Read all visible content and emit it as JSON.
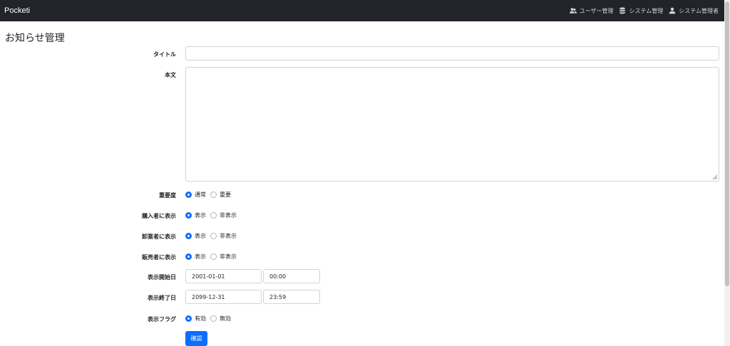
{
  "navbar": {
    "brand": "Pocketi",
    "items": [
      {
        "label": "ユーザー管理",
        "icon": "users-icon"
      },
      {
        "label": "システム管理",
        "icon": "database-icon"
      },
      {
        "label": "システム管理者",
        "icon": "user-icon"
      }
    ]
  },
  "page": {
    "title": "お知らせ管理"
  },
  "form": {
    "title_label": "タイトル",
    "title_value": "",
    "body_label": "本文",
    "body_value": "",
    "importance": {
      "label": "重要度",
      "options": [
        "通常",
        "重要"
      ],
      "selected": "通常"
    },
    "buyer_display": {
      "label": "購入者に表示",
      "options": [
        "表示",
        "非表示"
      ],
      "selected": "表示"
    },
    "wholesaler_display": {
      "label": "卸業者に表示",
      "options": [
        "表示",
        "非表示"
      ],
      "selected": "表示"
    },
    "seller_display": {
      "label": "販売者に表示",
      "options": [
        "表示",
        "非表示"
      ],
      "selected": "表示"
    },
    "start": {
      "label": "表示開始日",
      "date": "2001-01-01",
      "time": "00:00"
    },
    "end": {
      "label": "表示終了日",
      "date": "2099-12-31",
      "time": "23:59"
    },
    "flag": {
      "label": "表示フラグ",
      "options": [
        "有効",
        "無効"
      ],
      "selected": "有効"
    },
    "confirm_label": "確認"
  },
  "colors": {
    "navbar": "#212529",
    "primary": "#0d6efd",
    "border": "#ced4da"
  }
}
